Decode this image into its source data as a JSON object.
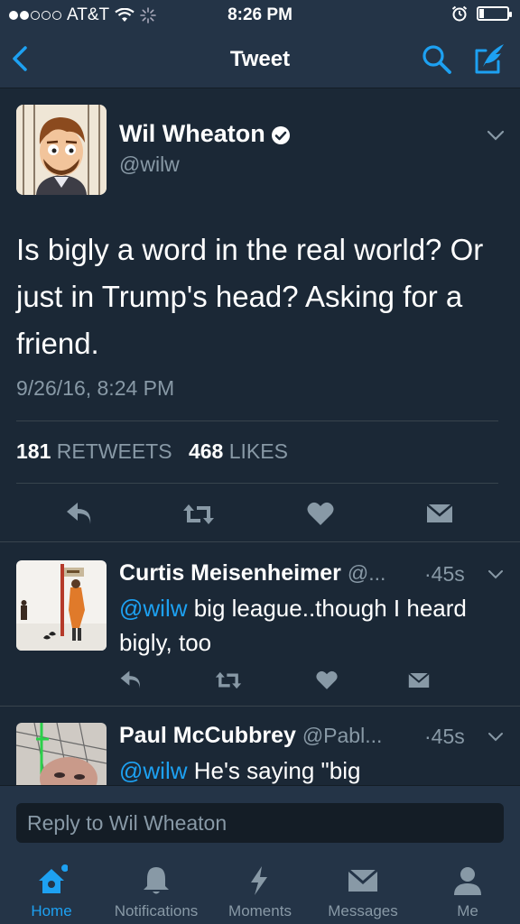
{
  "status_bar": {
    "carrier": "AT&T",
    "time": "8:26 PM"
  },
  "nav": {
    "title": "Tweet"
  },
  "main_tweet": {
    "author_name": "Wil Wheaton",
    "author_handle": "@wilw",
    "text": "Is bigly a word in the real world? Or just in Trump's head? Asking for a friend.",
    "timestamp": "9/26/16, 8:24 PM",
    "retweets_count": "181",
    "retweets_label": "RETWEETS",
    "likes_count": "468",
    "likes_label": "LIKES"
  },
  "replies": [
    {
      "name": "Curtis Meisenheimer",
      "handle": "@...",
      "time": "·45s",
      "mention": "@wilw",
      "text": " big league..though I heard bigly, too"
    },
    {
      "name": "Paul McCubbrey",
      "handle": "@Pabl...",
      "time": "·45s",
      "mention": "@wilw",
      "text": " He's saying \"big"
    }
  ],
  "reply_bar": {
    "placeholder": "Reply to Wil Wheaton"
  },
  "tabs": [
    {
      "label": "Home",
      "icon": "home-icon"
    },
    {
      "label": "Notifications",
      "icon": "bell-icon"
    },
    {
      "label": "Moments",
      "icon": "lightning-icon"
    },
    {
      "label": "Messages",
      "icon": "envelope-icon"
    },
    {
      "label": "Me",
      "icon": "person-icon"
    }
  ],
  "colors": {
    "background": "#1b2836",
    "bar": "#243447",
    "accent": "#1da1f2",
    "muted": "#8899a6"
  }
}
